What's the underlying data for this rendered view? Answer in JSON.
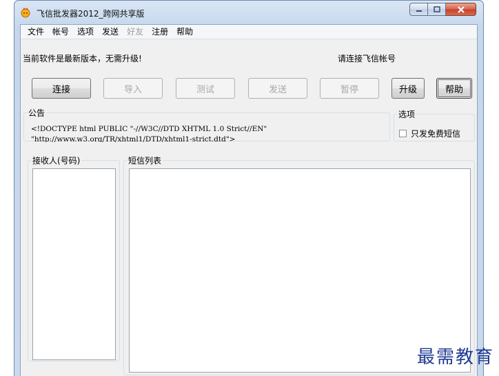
{
  "window": {
    "title": "飞信批发器2012_跨网共享版"
  },
  "menu": [
    {
      "label": "文件",
      "enabled": true
    },
    {
      "label": "帐号",
      "enabled": true
    },
    {
      "label": "选项",
      "enabled": true
    },
    {
      "label": "发送",
      "enabled": true
    },
    {
      "label": "好友",
      "enabled": false
    },
    {
      "label": "注册",
      "enabled": true
    },
    {
      "label": "帮助",
      "enabled": true
    }
  ],
  "status": {
    "version_message": "当前软件是最新版本，无需升级!",
    "login_prompt": "请连接飞信帐号"
  },
  "buttons": {
    "connect": "连接",
    "import": "导入",
    "test": "测试",
    "send": "发送",
    "pause": "暂停",
    "upgrade": "升级",
    "help": "帮助"
  },
  "notice": {
    "legend": "公告",
    "lines": [
      "<!DOCTYPE html PUBLIC \"-//W3C//DTD XHTML 1.0 Strict//EN\"",
      "\"http://www.w3.org/TR/xhtml1/DTD/xhtml1-strict.dtd\">"
    ]
  },
  "options": {
    "legend": "选项",
    "free_sms_only": "只发免费短信",
    "free_sms_checked": false
  },
  "recipients": {
    "legend": "接收人(号码)"
  },
  "sms_list": {
    "legend": "短信列表"
  },
  "watermark": "最需教育"
}
